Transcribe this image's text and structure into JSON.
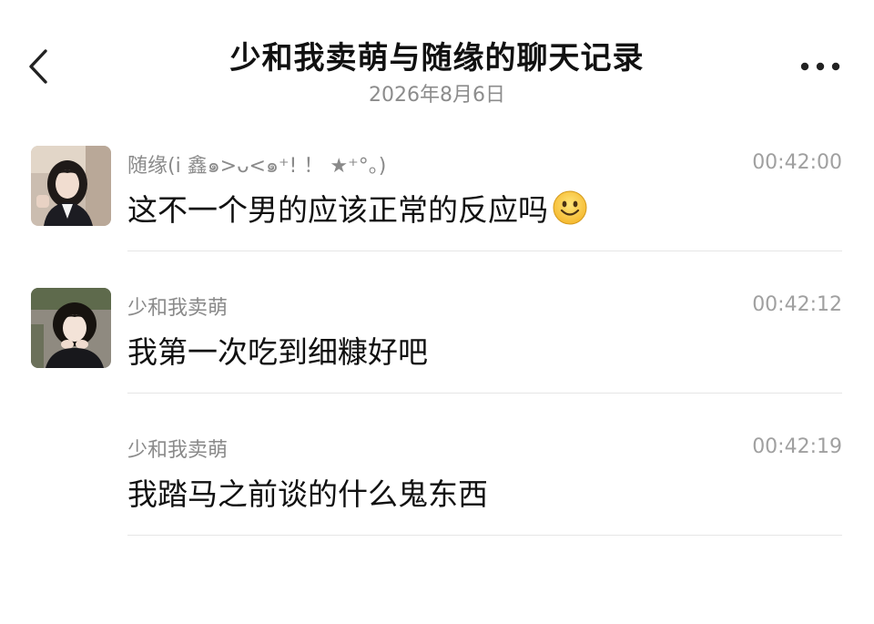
{
  "header": {
    "title": "少和我卖萌与随缘的聊天记录",
    "date": "2026年8月6日",
    "back_icon": "chevron-left-icon",
    "more_icon": "more-dots-icon"
  },
  "messages": [
    {
      "sender": "随缘(i 鑫๑>ᴗ<๑⁺! ！ ★⁺°。)",
      "time": "00:42:00",
      "text": "这不一个男的应该正常的反应吗",
      "emoji": "smile-emoji-icon",
      "has_avatar": true
    },
    {
      "sender": "少和我卖萌",
      "time": "00:42:12",
      "text": "我第一次吃到细糠好吧",
      "has_avatar": true
    },
    {
      "sender": "少和我卖萌",
      "time": "00:42:19",
      "text": "我踏马之前谈的什么鬼东西",
      "has_avatar": false
    }
  ]
}
